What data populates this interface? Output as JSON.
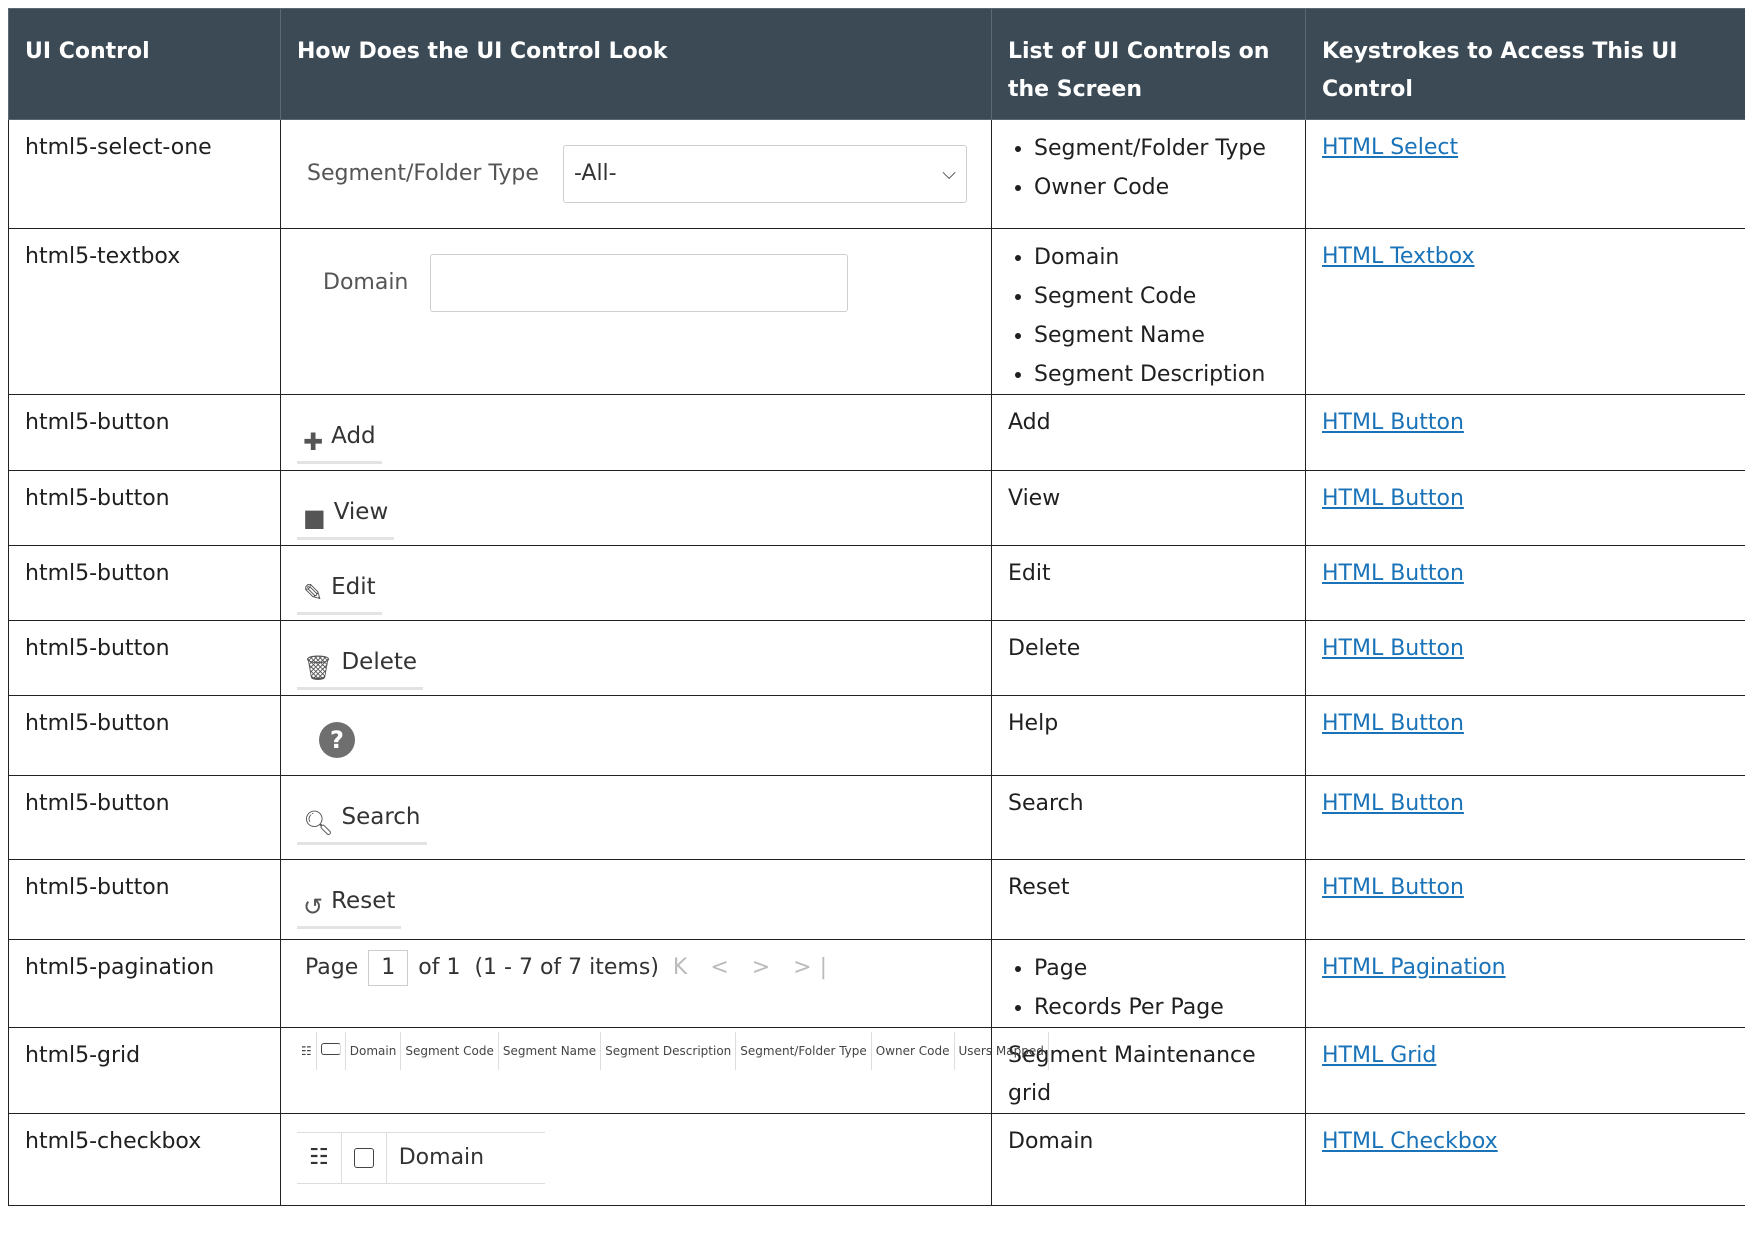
{
  "headers": {
    "col1": "UI Control",
    "col2": "How Does the UI Control Look",
    "col3": "List of UI Controls on the Screen",
    "col4": "Keystrokes to Access This UI Control"
  },
  "rows": [
    {
      "control": "html5-select-one",
      "items": [
        "Segment/Folder Type",
        "Owner Code"
      ],
      "link": "HTML Select",
      "mock": {
        "label": "Segment/Folder Type",
        "value": "-All-"
      }
    },
    {
      "control": "html5-textbox",
      "items": [
        "Domain",
        "Segment Code",
        "Segment Name",
        "Segment Description"
      ],
      "link": "HTML Textbox",
      "mock": {
        "label": "Domain"
      }
    },
    {
      "control": "html5-button",
      "items_text": "Add",
      "link": "HTML Button",
      "mock": {
        "label": "Add"
      }
    },
    {
      "control": "html5-button",
      "items_text": "View",
      "link": "HTML Button",
      "mock": {
        "label": "View"
      }
    },
    {
      "control": "html5-button",
      "items_text": "Edit",
      "link": "HTML Button",
      "mock": {
        "label": "Edit"
      }
    },
    {
      "control": "html5-button",
      "items_text": "Delete",
      "link": "HTML Button",
      "mock": {
        "label": "Delete"
      }
    },
    {
      "control": "html5-button",
      "items_text": "Help",
      "link": "HTML Button",
      "mock": {
        "label": "?"
      }
    },
    {
      "control": "html5-button",
      "items_text": "Search",
      "link": "HTML Button",
      "mock": {
        "label": "Search"
      }
    },
    {
      "control": "html5-button",
      "items_text": "Reset",
      "link": "HTML Button",
      "mock": {
        "label": "Reset"
      }
    },
    {
      "control": "html5-pagination",
      "items": [
        "Page",
        "Records Per Page"
      ],
      "link": "HTML Pagination",
      "mock": {
        "page": "Page",
        "page_num": "1",
        "of": "of 1",
        "range": "(1 - 7 of  7  items)",
        "nav": "K < > >|"
      }
    },
    {
      "control": "html5-grid",
      "items_text": "Segment Maintenance grid",
      "link": "HTML Grid",
      "mock": {
        "cols": [
          "Domain",
          "Segment Code",
          "Segment Name",
          "Segment Description",
          "Segment/Folder Type",
          "Owner Code",
          "Users Mapped"
        ]
      }
    },
    {
      "control": "html5-checkbox",
      "items_text": "Domain",
      "link": "HTML Checkbox",
      "mock": {
        "label": "Domain"
      }
    }
  ]
}
